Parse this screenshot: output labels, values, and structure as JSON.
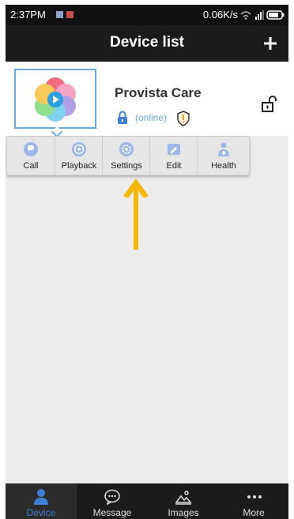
{
  "status_bar": {
    "time": "2:37PM",
    "speed": "0.06K/s",
    "icons": [
      "wifi-icon",
      "signal-icon",
      "battery-icon"
    ]
  },
  "header": {
    "title": "Device list",
    "add_icon": "plus-icon"
  },
  "device": {
    "name": "Provista Care",
    "status": "(online)",
    "thumbnail_icon": "flower-app-icon",
    "status_color": "#6aa9e8"
  },
  "actions": [
    {
      "label": "Call",
      "icon": "call-icon"
    },
    {
      "label": "Playback",
      "icon": "playback-icon"
    },
    {
      "label": "Settings",
      "icon": "settings-icon"
    },
    {
      "label": "Edit",
      "icon": "edit-icon"
    },
    {
      "label": "Health",
      "icon": "health-icon"
    }
  ],
  "annotation": {
    "color": "#f5b800"
  },
  "bottom_nav": [
    {
      "label": "Device",
      "icon": "person-icon",
      "active": true
    },
    {
      "label": "Message",
      "icon": "chat-bubble-icon",
      "active": false
    },
    {
      "label": "Images",
      "icon": "image-icon",
      "active": false
    },
    {
      "label": "More",
      "icon": "more-dots-icon",
      "active": false
    }
  ],
  "colors": {
    "accent": "#3e7fd6",
    "header_bg": "#1b1b1b",
    "body_bg": "#ececec"
  }
}
